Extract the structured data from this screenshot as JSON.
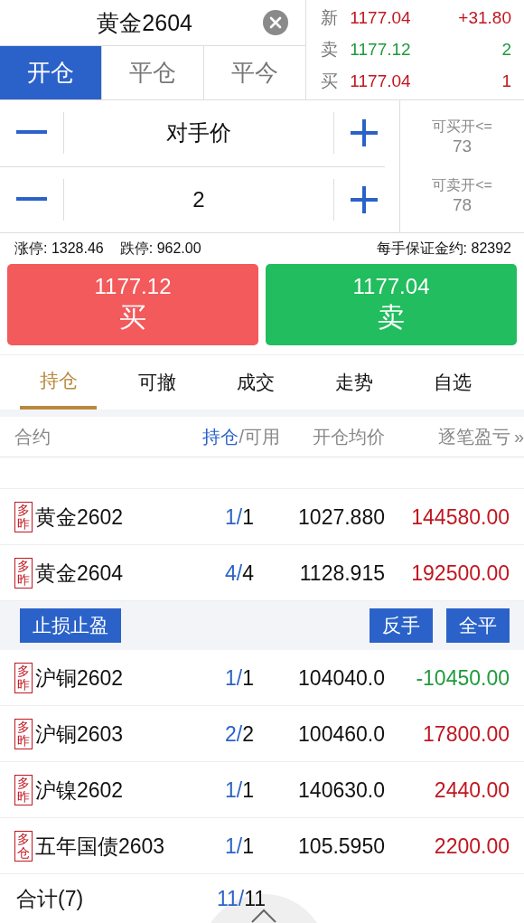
{
  "header": {
    "contract": "黄金2604"
  },
  "order_tabs": [
    {
      "label": "开仓",
      "selected": true
    },
    {
      "label": "平仓",
      "selected": false
    },
    {
      "label": "平今",
      "selected": false
    }
  ],
  "quote": [
    {
      "label": "新",
      "price": "1177.04",
      "value": "+31.80",
      "color": "#c0161f"
    },
    {
      "label": "卖",
      "price": "1177.12",
      "value": "2",
      "color": "#1e9a3c"
    },
    {
      "label": "买",
      "price": "1177.04",
      "value": "1",
      "color": "#c0161f"
    }
  ],
  "price_field": {
    "value": "对手价"
  },
  "quantity_field": {
    "value": "2"
  },
  "limits": [
    {
      "label": "可买开<=",
      "value": "73"
    },
    {
      "label": "可卖开<=",
      "value": "78"
    }
  ],
  "info": {
    "limit_up": "涨停: 1328.46",
    "limit_down": "跌停: 962.00",
    "margin": "每手保证金约: 82392"
  },
  "trade_buttons": [
    {
      "kind": "buy",
      "price": "1177.12",
      "label": "买"
    },
    {
      "kind": "sell",
      "price": "1177.04",
      "label": "卖"
    }
  ],
  "section_tabs": [
    {
      "label": "持仓",
      "selected": true
    },
    {
      "label": "可撤",
      "selected": false
    },
    {
      "label": "成交",
      "selected": false
    },
    {
      "label": "走势",
      "selected": false
    },
    {
      "label": "自选",
      "selected": false
    }
  ],
  "table": {
    "columns": [
      {
        "label": "合约"
      },
      {
        "label": "持仓",
        "suffix": "/可用"
      },
      {
        "label": "开仓均价"
      },
      {
        "label": "逐笔盈亏",
        "more": "»"
      }
    ],
    "rows": [
      {
        "kind": "position",
        "tag": "多昨",
        "name": "黄金2602",
        "held": "1/",
        "available": "1",
        "avg_price": "1027.880",
        "pnl": "144580.00",
        "color": "#c0161f"
      },
      {
        "kind": "position",
        "tag": "多昨",
        "name": "黄金2604",
        "held": "4/",
        "available": "4",
        "avg_price": "1128.915",
        "pnl": "192500.00",
        "color": "#c0161f"
      },
      {
        "kind": "actions",
        "left": [
          "止损止盈"
        ],
        "right": [
          "反手",
          "全平"
        ]
      },
      {
        "kind": "position",
        "tag": "多昨",
        "name": "沪铜2602",
        "held": "1/",
        "available": "1",
        "avg_price": "104040.0",
        "pnl": "-10450.00",
        "color": "#1e9a3c"
      },
      {
        "kind": "position",
        "tag": "多昨",
        "name": "沪铜2603",
        "held": "2/",
        "available": "2",
        "avg_price": "100460.0",
        "pnl": "17800.00",
        "color": "#c0161f"
      },
      {
        "kind": "position",
        "tag": "多昨",
        "name": "沪镍2602",
        "held": "1/",
        "available": "1",
        "avg_price": "140630.0",
        "pnl": "2440.00",
        "color": "#c0161f"
      },
      {
        "kind": "position",
        "tag": "多仓",
        "name": "五年国债2603",
        "held": "1/",
        "available": "1",
        "avg_price": "105.5950",
        "pnl": "2200.00",
        "color": "#c0161f"
      }
    ],
    "total": {
      "label": "合计(7)",
      "held": "11/",
      "available": "11"
    }
  }
}
